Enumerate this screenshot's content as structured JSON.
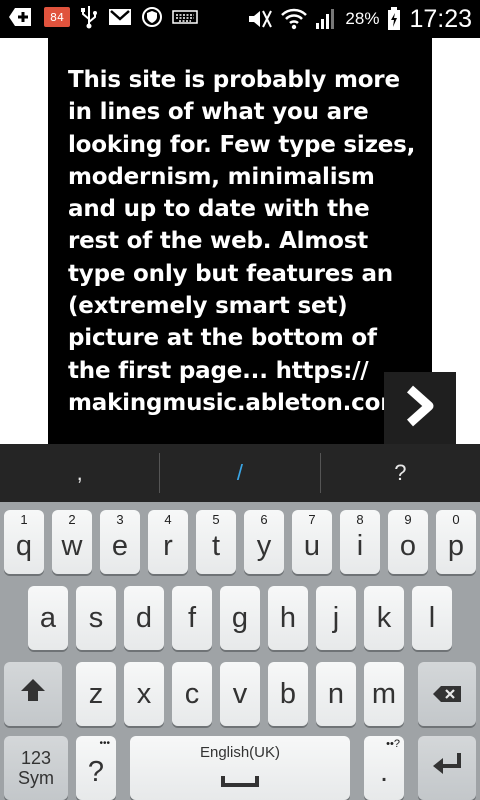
{
  "status_bar": {
    "notification_count": "84",
    "battery": "28%",
    "time": "17:23"
  },
  "post": {
    "text": "This site is probably more in lines of what you are looking for. Few type sizes, modernism, minimalism and up to date with the rest of the web. Almost type only but features an (extremely smart set) picture at the bottom of the first page... https:// makingmusic.ableton.com"
  },
  "suggestions": [
    ",",
    "/",
    "?"
  ],
  "keyboard": {
    "row1": [
      {
        "hint": "1",
        "label": "q"
      },
      {
        "hint": "2",
        "label": "w"
      },
      {
        "hint": "3",
        "label": "e"
      },
      {
        "hint": "4",
        "label": "r"
      },
      {
        "hint": "5",
        "label": "t"
      },
      {
        "hint": "6",
        "label": "y"
      },
      {
        "hint": "7",
        "label": "u"
      },
      {
        "hint": "8",
        "label": "i"
      },
      {
        "hint": "9",
        "label": "o"
      },
      {
        "hint": "0",
        "label": "p"
      }
    ],
    "row2": [
      "a",
      "s",
      "d",
      "f",
      "g",
      "h",
      "j",
      "k",
      "l"
    ],
    "row3": [
      "z",
      "x",
      "c",
      "v",
      "b",
      "n",
      "m"
    ],
    "sym_line1": "123",
    "sym_line2": "Sym",
    "question_hint": "•••",
    "question_label": "?",
    "space_label": "English(UK)",
    "period_hint": "••?",
    "period_label": "."
  }
}
